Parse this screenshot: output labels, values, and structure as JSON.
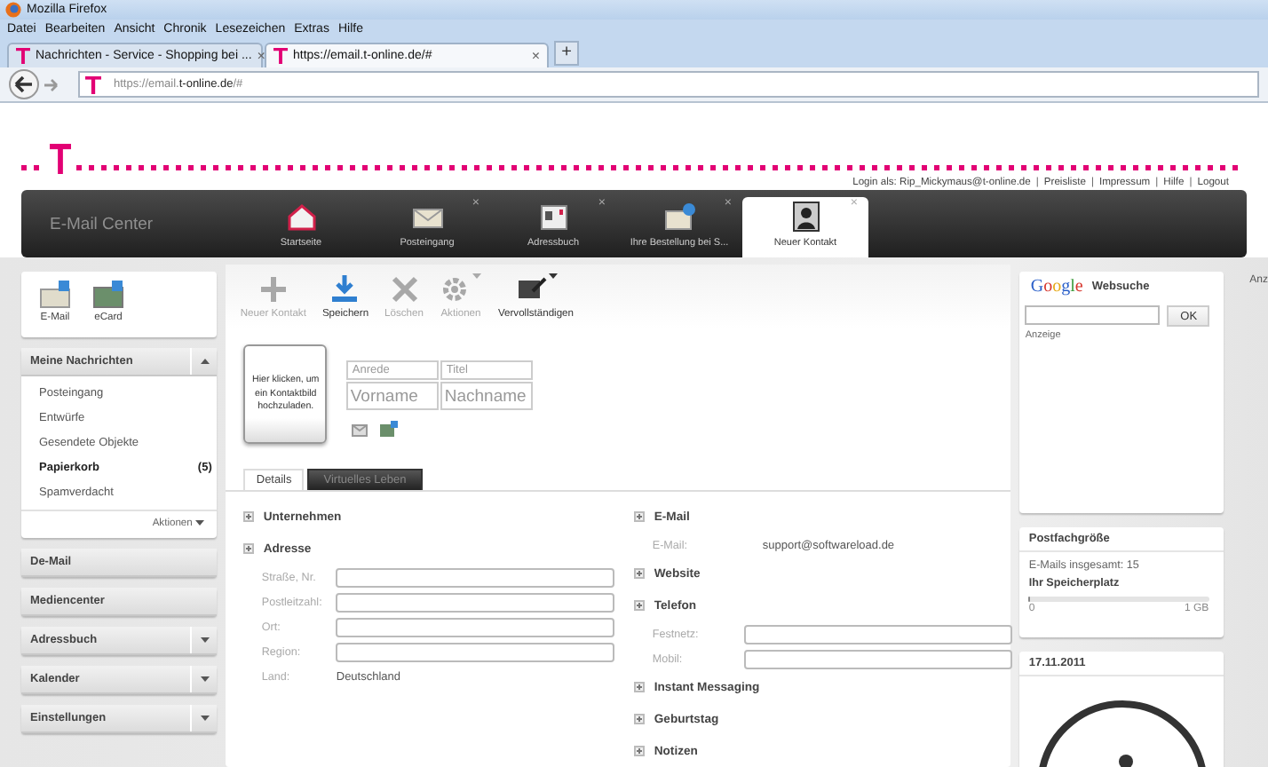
{
  "browser": {
    "title": "Mozilla Firefox",
    "menu": [
      "Datei",
      "Bearbeiten",
      "Ansicht",
      "Chronik",
      "Lesezeichen",
      "Extras",
      "Hilfe"
    ],
    "tabs": [
      {
        "label": "Nachrichten - Service - Shopping bei ...",
        "selected": false,
        "close": "×"
      },
      {
        "label": "https://email.t-online.de/#",
        "selected": true,
        "close": "×"
      }
    ],
    "new_tab": "+",
    "url": "https://email.**t-online.de**/#"
  },
  "header": {
    "login": "Login als: Rip_Mickymaus@t-online.de",
    "separator": "|",
    "links": [
      "Preisliste",
      "Impressum",
      "Hilfe",
      "Logout"
    ]
  },
  "app_bar": {
    "title": "E-Mail Center",
    "close": "×",
    "tabs": [
      {
        "label": "Startseite",
        "kind": "home",
        "closable": false,
        "selected": false
      },
      {
        "label": "Posteingang",
        "kind": "inbox",
        "closable": true,
        "selected": false
      },
      {
        "label": "Adressbuch",
        "kind": "addressbook",
        "closable": true,
        "selected": false
      },
      {
        "label": "Ihre Bestellung bei S...",
        "kind": "mail",
        "closable": true,
        "selected": false
      },
      {
        "label": "Neuer Kontakt",
        "kind": "person",
        "closable": true,
        "selected": true
      }
    ]
  },
  "sidebar": {
    "quick": [
      {
        "label": "E-Mail",
        "kind": "email"
      },
      {
        "label": "eCard",
        "kind": "ecard"
      }
    ],
    "sections": [
      {
        "title": "Meine Nachrichten",
        "kind": "folder",
        "expanded": true,
        "actions": "Aktionen",
        "items": [
          {
            "label": "Posteingang",
            "selected": false
          },
          {
            "label": "Entwürfe",
            "selected": false
          },
          {
            "label": "Gesendete Objekte",
            "selected": false
          },
          {
            "label": "Papierkorb",
            "count": "(5)",
            "selected": true
          },
          {
            "label": "Spamverdacht",
            "selected": false
          }
        ]
      },
      {
        "title": "De-Mail",
        "kind": "link"
      },
      {
        "title": "Mediencenter",
        "kind": "link"
      },
      {
        "title": "Adressbuch",
        "kind": "folder",
        "expanded": false
      },
      {
        "title": "Kalender",
        "kind": "folder",
        "expanded": false
      },
      {
        "title": "Einstellungen",
        "kind": "folder",
        "expanded": false
      }
    ]
  },
  "toolbar": [
    {
      "label": "Neuer Kontakt",
      "kind": "plus",
      "disabled": true,
      "menu": false
    },
    {
      "label": "Speichern",
      "kind": "save",
      "disabled": false,
      "menu": false
    },
    {
      "label": "Löschen",
      "kind": "delete",
      "disabled": true,
      "menu": false
    },
    {
      "label": "Aktionen",
      "kind": "gear",
      "disabled": true,
      "menu": true
    },
    {
      "label": "Vervollständigen",
      "kind": "card",
      "disabled": false,
      "menu": true
    }
  ],
  "contact": {
    "photo_button": "Hier klicken, um ein Kontaktbild hochzuladen.",
    "small_fields": [
      {
        "placeholder": "Anrede"
      },
      {
        "placeholder": "Titel"
      }
    ],
    "name_fields": [
      {
        "placeholder": "Vorname"
      },
      {
        "placeholder": "Nachname"
      }
    ]
  },
  "detail_tabs": [
    {
      "label": "Details",
      "selected": true
    },
    {
      "label": "Virtuelles Leben",
      "selected": false
    }
  ],
  "left_sections": [
    {
      "title": "Unternehmen"
    },
    {
      "title": "Adresse",
      "fields": [
        {
          "label": "Straße, Nr.",
          "kind": "input"
        },
        {
          "label": "Postleitzahl:",
          "kind": "input"
        },
        {
          "label": "Ort:",
          "kind": "input"
        },
        {
          "label": "Region:",
          "kind": "input"
        },
        {
          "label": "Land:",
          "kind": "text",
          "value": "Deutschland"
        }
      ]
    }
  ],
  "right_sections": [
    {
      "title": "E-Mail",
      "fields": [
        {
          "label": "E-Mail:",
          "kind": "text",
          "value": "support@softwareload.de"
        }
      ]
    },
    {
      "title": "Website"
    },
    {
      "title": "Telefon",
      "fields": [
        {
          "label": "Festnetz:",
          "kind": "input"
        },
        {
          "label": "Mobil:",
          "kind": "input"
        }
      ]
    },
    {
      "title": "Instant Messaging"
    },
    {
      "title": "Geburtstag"
    },
    {
      "title": "Notizen"
    }
  ],
  "websearch": {
    "logo": "Google",
    "title": "Websuche",
    "button": "OK",
    "ad_label": "Anzeige"
  },
  "storage": {
    "title": "Postfachgröße",
    "total": "E-Mails insgesamt: 15",
    "subtitle": "Ihr Speicherplatz",
    "level": 0.01,
    "min": "0",
    "max": "1 GB"
  },
  "date_widget": {
    "title": "17.11.2011"
  },
  "edge_text": "Anz"
}
